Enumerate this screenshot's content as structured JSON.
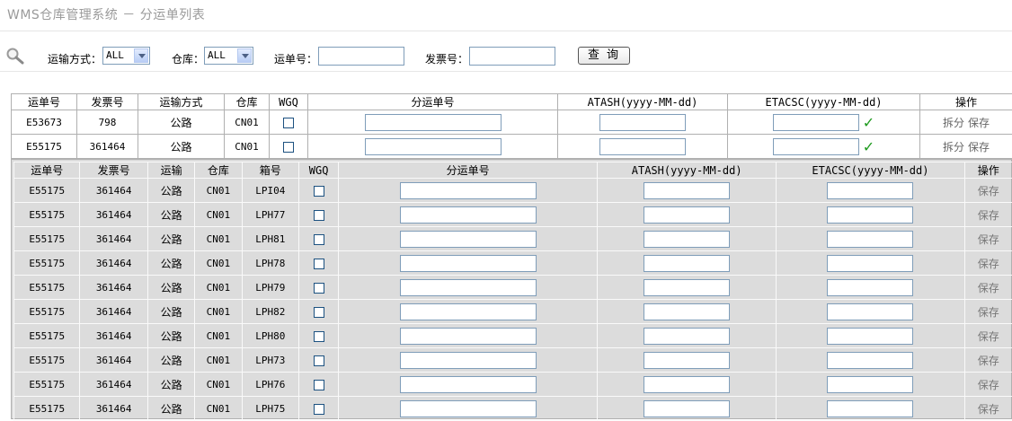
{
  "page": {
    "title": "WMS仓库管理系统 － 分运单列表"
  },
  "search": {
    "transport_label": "运输方式：",
    "transport_value": "ALL",
    "warehouse_label": "仓库：",
    "warehouse_value": "ALL",
    "waybill_label": "运单号：",
    "invoice_label": "发票号：",
    "query_button": "查询"
  },
  "main_table": {
    "headers": [
      "运单号",
      "发票号",
      "运输方式",
      "仓库",
      "WGQ",
      "分运单号",
      "ATASH(yyyy-MM-dd)",
      "ETACSC(yyyy-MM-dd)",
      "操作"
    ],
    "rows": [
      {
        "waybill": "E53673",
        "invoice": "798",
        "transport": "公路",
        "warehouse": "CN01",
        "split": "拆分",
        "save": "保存"
      },
      {
        "waybill": "E55175",
        "invoice": "361464",
        "transport": "公路",
        "warehouse": "CN01",
        "split": "拆分",
        "save": "保存"
      }
    ]
  },
  "sub_table": {
    "headers": [
      "运单号",
      "发票号",
      "运输",
      "仓库",
      "箱号",
      "WGQ",
      "分运单号",
      "ATASH(yyyy-MM-dd)",
      "ETACSC(yyyy-MM-dd)",
      "操作"
    ],
    "rows": [
      {
        "waybill": "E55175",
        "invoice": "361464",
        "transport": "公路",
        "warehouse": "CN01",
        "box": "LPI04",
        "save": "保存"
      },
      {
        "waybill": "E55175",
        "invoice": "361464",
        "transport": "公路",
        "warehouse": "CN01",
        "box": "LPH77",
        "save": "保存"
      },
      {
        "waybill": "E55175",
        "invoice": "361464",
        "transport": "公路",
        "warehouse": "CN01",
        "box": "LPH81",
        "save": "保存"
      },
      {
        "waybill": "E55175",
        "invoice": "361464",
        "transport": "公路",
        "warehouse": "CN01",
        "box": "LPH78",
        "save": "保存"
      },
      {
        "waybill": "E55175",
        "invoice": "361464",
        "transport": "公路",
        "warehouse": "CN01",
        "box": "LPH79",
        "save": "保存"
      },
      {
        "waybill": "E55175",
        "invoice": "361464",
        "transport": "公路",
        "warehouse": "CN01",
        "box": "LPH82",
        "save": "保存"
      },
      {
        "waybill": "E55175",
        "invoice": "361464",
        "transport": "公路",
        "warehouse": "CN01",
        "box": "LPH80",
        "save": "保存"
      },
      {
        "waybill": "E55175",
        "invoice": "361464",
        "transport": "公路",
        "warehouse": "CN01",
        "box": "LPH73",
        "save": "保存"
      },
      {
        "waybill": "E55175",
        "invoice": "361464",
        "transport": "公路",
        "warehouse": "CN01",
        "box": "LPH76",
        "save": "保存"
      },
      {
        "waybill": "E55175",
        "invoice": "361464",
        "transport": "公路",
        "warehouse": "CN01",
        "box": "LPH75",
        "save": "保存"
      }
    ]
  },
  "colors": {
    "check": "#1d9a1d",
    "sub_bg": "#dcdcdc",
    "title": "#9a9a9a"
  },
  "icons": {
    "search": "magnifier-icon",
    "confirm": "checkmark-icon"
  }
}
